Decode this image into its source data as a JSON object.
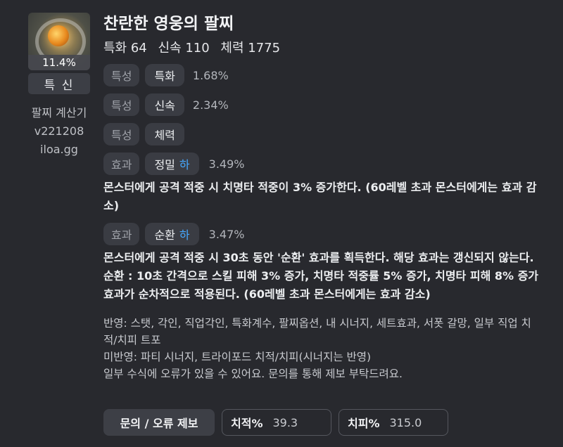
{
  "item": {
    "percent": "11.4%",
    "badge": "특 신",
    "calculator_name": "팔찌 계산기",
    "version": "v221208",
    "site": "iloa.gg"
  },
  "title": "찬란한 영웅의 팔찌",
  "stats": [
    "특화 64",
    "신속 110",
    "체력 1775"
  ],
  "traits": [
    {
      "type": "특성",
      "name": "특화",
      "value": "1.68%"
    },
    {
      "type": "특성",
      "name": "신속",
      "value": "2.34%"
    },
    {
      "type": "특성",
      "name": "체력",
      "value": ""
    }
  ],
  "effects": [
    {
      "type": "효과",
      "name": "정밀",
      "level": "하",
      "value": "3.49%",
      "description": "몬스터에게 공격 적중 시 치명타 적중이 3% 증가한다. (60레벨 초과 몬스터에게는 효과 감소)"
    },
    {
      "type": "효과",
      "name": "순환",
      "level": "하",
      "value": "3.47%",
      "description": "몬스터에게 공격 적중 시 30초 동안 '순환' 효과를 획득한다. 해당 효과는 갱신되지 않는다. 순환 : 10초 간격으로 스킬 피해 3% 증가, 치명타 적중률 5% 증가, 치명타 피해 8% 증가 효과가 순차적으로 적용된다. (60레벨 초과 몬스터에게는 효과 감소)"
    }
  ],
  "notes": {
    "reflected": "반영: 스탯, 각인, 직업각인, 특화계수, 팔찌옵션, 내 시너지, 세트효과, 서폿 갈망, 일부 직업 치적/치피 트포",
    "not_reflected": "미반영: 파티 시너지, 트라이포드 치적/치피(시너지는 반영)",
    "disclaimer": "일부 수식에 오류가 있을 수 있어요. 문의를 통해 제보 부탁드려요."
  },
  "bottom": {
    "report_button": "문의 / 오류 제보",
    "crit_rate_label": "치적%",
    "crit_rate_value": "39.3",
    "crit_dmg_label": "치피%",
    "crit_dmg_value": "315.0"
  }
}
